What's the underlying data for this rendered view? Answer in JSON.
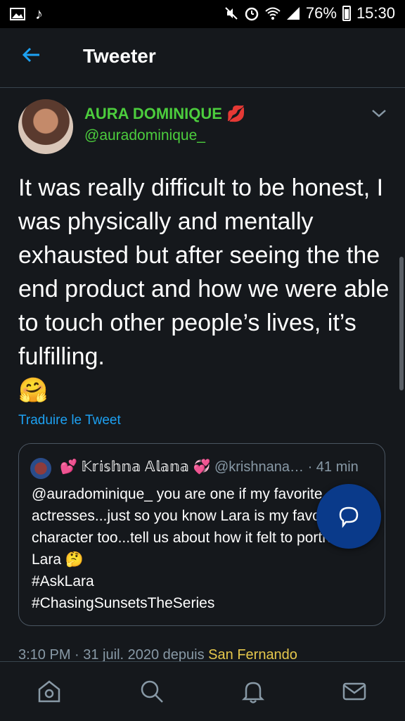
{
  "statusbar": {
    "battery_percent": "76%",
    "time": "15:30",
    "icons": [
      "image-icon",
      "music-note-icon",
      "mute-icon",
      "alarm-icon",
      "wifi-icon",
      "signal-icon",
      "battery-icon"
    ]
  },
  "header": {
    "title": "Tweeter",
    "back_icon": "arrow-left-icon"
  },
  "tweet": {
    "author_name": "AURA DOMINIQUE",
    "author_emoji": "💋",
    "author_handle": "@auradominique_",
    "text": "It was really difficult to be honest, I was physically and mentally exhausted but after seeing the the end product and how we were able to touch other people’s lives, it’s fulfilling.",
    "emoji": "🤗",
    "translate_label": "Traduire le Tweet",
    "meta_time": "3:10 PM · 31 juil. 2020 depuis",
    "meta_location": "San Fernando",
    "colors": {
      "name": "#4ccd3d",
      "link": "#1da1f2",
      "meta": "#8899a6",
      "location": "#e6c84c"
    }
  },
  "quote": {
    "display_name": "𝕂𝕣𝕚𝕤𝕙𝕟𝕒 𝔸𝕝𝕒𝕟𝕒",
    "handle": "@krishnana…",
    "time": "· 41 min",
    "text": "@auradominique_ you are one if my favorite actresses...just so you know Lara is my favorite character too...tell us about how it felt to portray Lara",
    "emoji": "🤔",
    "hashtags": [
      "#AskLara",
      "#ChasingSunsetsTheSeries"
    ]
  },
  "nav": {
    "items": [
      "home-icon",
      "search-icon",
      "notifications-icon",
      "messages-icon"
    ]
  },
  "fab": {
    "icon": "reply-icon",
    "color": "#0a3a8a"
  }
}
